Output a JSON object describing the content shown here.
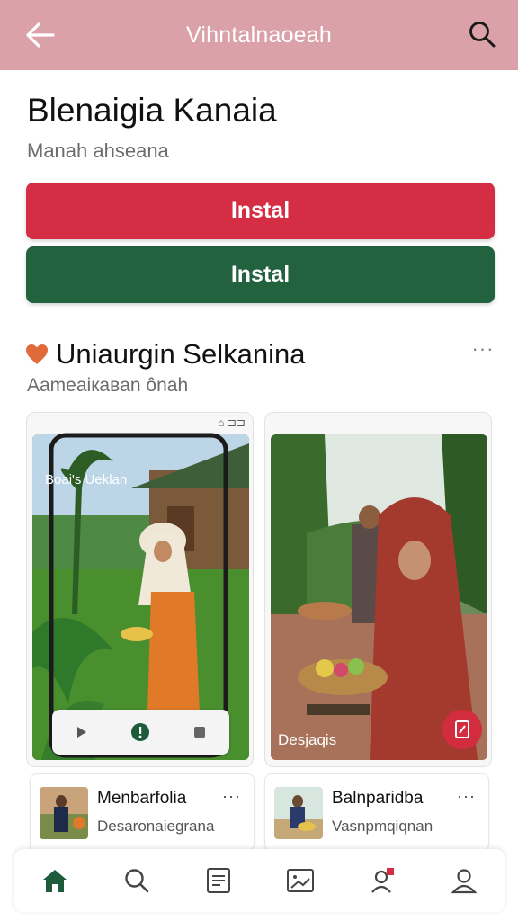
{
  "header": {
    "title": "Vihntalnaoeah",
    "back_icon": "arrow-left-icon",
    "search_icon": "search-icon",
    "background": "#dba1a8"
  },
  "app": {
    "title": "Blenaigia Kanaia",
    "subtitle": "Manah ahseana"
  },
  "buttons": {
    "primary_label": "Instal",
    "secondary_label": "Instal",
    "primary_color": "#d42d44",
    "secondary_color": "#23623f"
  },
  "section": {
    "title": "Uniaurgin Selkanina",
    "subtitle": "Aameaiкaвan ônah",
    "icon": "heart-icon",
    "more": "···"
  },
  "cards": [
    {
      "badge": "⌂ ⊐⊐",
      "overlay_title": "Boai's Ueklan",
      "controls": [
        "play-icon",
        "record-icon",
        "stop-icon"
      ]
    },
    {
      "caption": "Desjaqis",
      "fab_icon": "bookmark-icon"
    }
  ],
  "channels": [
    {
      "name": "Menbarfolia",
      "desc": "Desaronaiegrana",
      "more": "···"
    },
    {
      "name": "Balnparidba",
      "desc": "Vasnpmqiqnan",
      "more": "···"
    }
  ],
  "nav": {
    "items": [
      "home-icon",
      "search-icon",
      "document-icon",
      "gallery-icon",
      "notification-user-icon",
      "profile-icon"
    ],
    "active": "home-icon",
    "accent": "#1e5b3a"
  }
}
